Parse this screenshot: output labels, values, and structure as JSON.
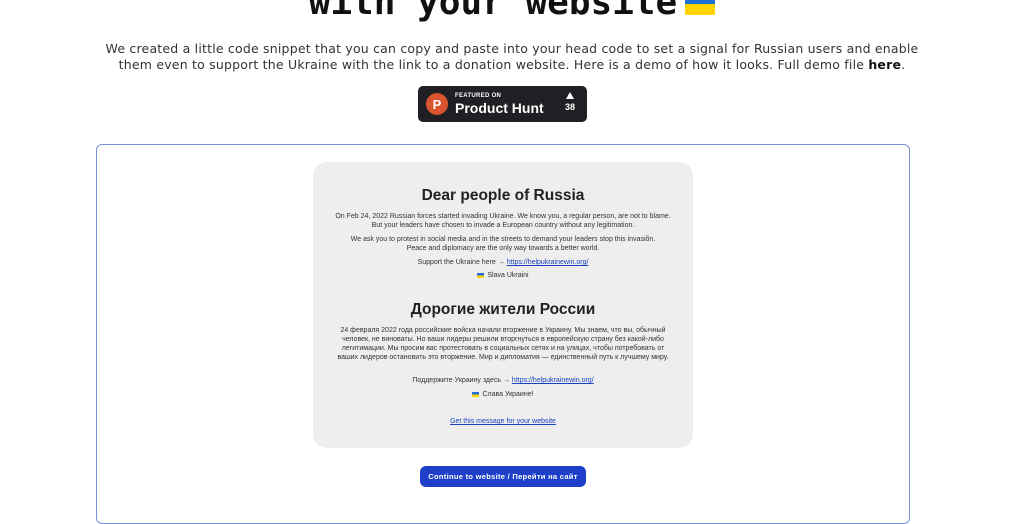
{
  "hero": {
    "title": "with your website"
  },
  "intro": {
    "text": "We created a little code snippet that you can copy and paste into your head code to set a signal for Russian users and enable them even to support the Ukraine with the link to a donation website. Here is a demo of how it looks. Full demo file ",
    "link": "here",
    "trail": "."
  },
  "product_hunt": {
    "featured": "FEATURED ON",
    "name": "Product Hunt",
    "logo_letter": "P",
    "votes": "38"
  },
  "message": {
    "en_heading": "Dear people of Russia",
    "en_p1": "On Feb 24, 2022 Russian forces started invading Ukraine. We know you, a regular person, are not to blame. But your leaders have chosen to invade a European country without any legitimation.",
    "en_p2": "We ask you to protest in social media and in the streets to demand your leaders stop this invasiõn. Peace and diplomacy are the only way towards a better world.",
    "en_support": "Support the Ukraine here → ",
    "en_link": "https://helpukrainewin.org/",
    "en_slava": "Slava Ukraini",
    "ru_heading": "Дорогие жители России",
    "ru_p1": "24 февраля 2022 года российские войска начали вторжение в Украину. Мы знаем, что вы, обычный человек, не виноваты. Но ваши лидеры решили вторгнуться в европейскую страну без какой-либо легитимации. Мы просим вас протестовать в социальных сетях и на улицах, чтобы потребовать от ваших лидеров остановить это вторжение. Мир и дипломатия — единственный путь к лучшему миру.",
    "ru_support": "Поддержите Украину здесь → ",
    "ru_link": "https://helpukrainewin.org/",
    "ru_slava": "Слава Украине!",
    "get_message": "Get this message for your website"
  },
  "continue_button": "Continue to website / Перейти на сайт",
  "colors": {
    "accent": "#1d3fc9",
    "frame_border": "#7b93d6",
    "product_hunt_orange": "#da552f",
    "flag_blue": "#1f6fd6",
    "flag_yellow": "#ffd500"
  }
}
